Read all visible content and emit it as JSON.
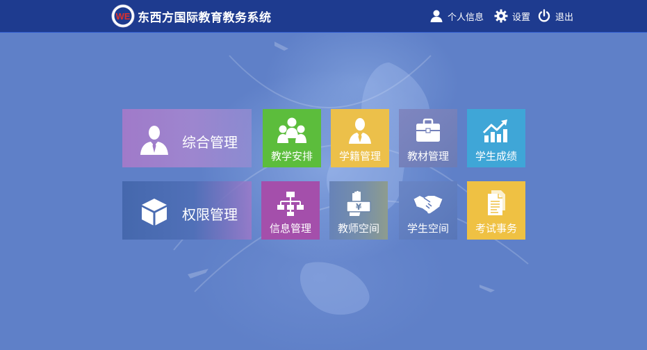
{
  "header": {
    "title": "东西方国际教育教务系统",
    "logo_text": "WE",
    "nav": [
      {
        "label": "个人信息",
        "icon": "user-icon"
      },
      {
        "label": "设置",
        "icon": "gear-icon"
      },
      {
        "label": "退出",
        "icon": "power-icon"
      }
    ]
  },
  "tiles": [
    {
      "label": "综合管理",
      "icon": "person-tie-icon",
      "color": "#a278c8"
    },
    {
      "label": "教学安排",
      "icon": "group-icon",
      "color": "#5cbd3c"
    },
    {
      "label": "学籍管理",
      "icon": "student-icon",
      "color": "#ecc04a"
    },
    {
      "label": "教材管理",
      "icon": "briefcase-icon",
      "color": "#6f7fb8"
    },
    {
      "label": "学生成绩",
      "icon": "growth-chart-icon",
      "color": "#3fa6d7"
    },
    {
      "label": "权限管理",
      "icon": "cube-icon",
      "color": "#4a6bb0"
    },
    {
      "label": "信息管理",
      "icon": "org-chart-icon",
      "color": "#a44fab"
    },
    {
      "label": "教师空间",
      "icon": "hand-money-icon",
      "color": "#6a8aa8"
    },
    {
      "label": "学生空间",
      "icon": "handshake-icon",
      "color": "#5e78b8"
    },
    {
      "label": "考试事务",
      "icon": "document-icon",
      "color": "#efc143"
    }
  ]
}
